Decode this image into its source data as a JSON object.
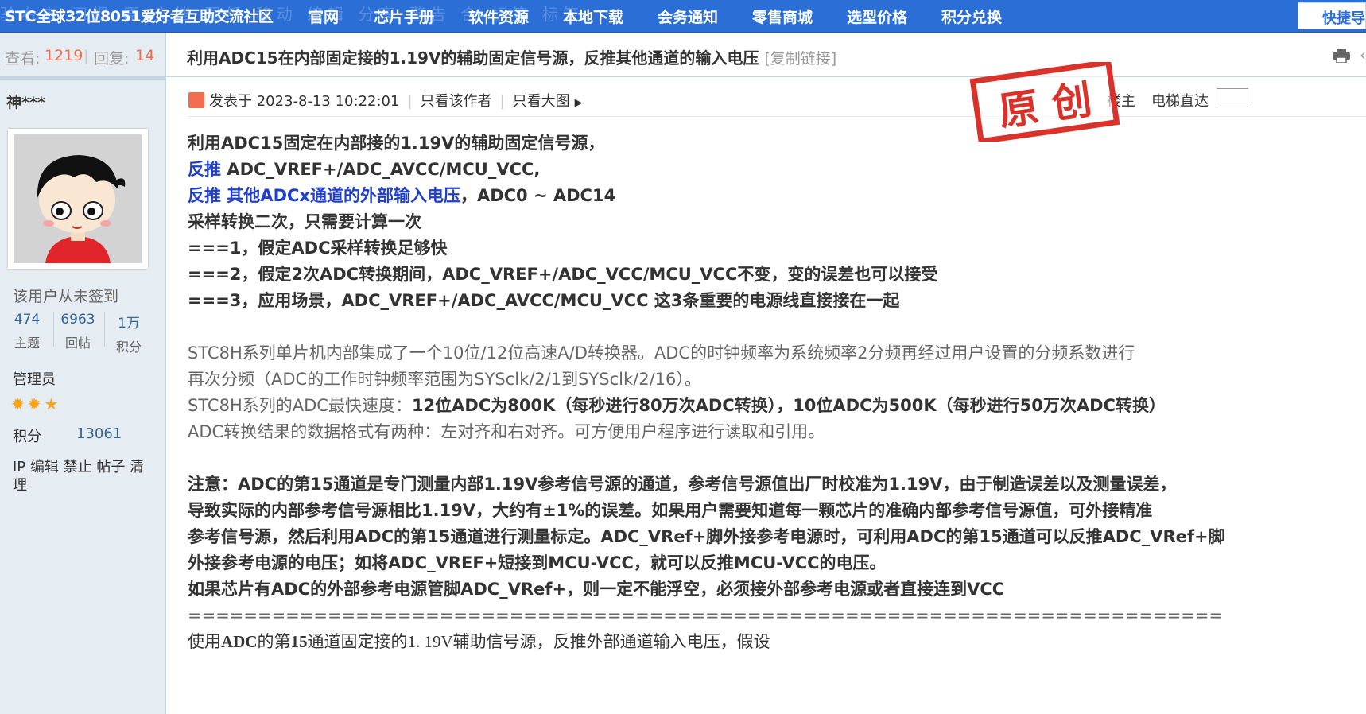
{
  "topnav": {
    "site_title": "STC全球32位8051爱好者互助交流社区",
    "ghost_text": "验右市 习惯 原 文档 图纸 移动 编辑 分享 警告 合 标签 标签",
    "items": [
      "官网",
      "芯片手册",
      "软件资源",
      "本地下载",
      "会务通知",
      "零售商城",
      "选型价格",
      "积分兑换"
    ],
    "quick_label": "快捷导"
  },
  "stats": {
    "views_label": "查看:",
    "views": "1219",
    "replies_label": "回复:",
    "replies": "14"
  },
  "thread": {
    "title": "利用ADC15在内部固定接的1.19V的辅助固定信号源，反推其他通道的输入电压",
    "copy_link": "[复制链接]"
  },
  "author": {
    "name": "神***",
    "signin": "该用户从未签到",
    "stats": [
      {
        "value": "474",
        "label": "主题"
      },
      {
        "value": "6963",
        "label": "回帖"
      },
      {
        "value": "1万",
        "label": "积分"
      }
    ],
    "role": "管理员",
    "credit_label": "积分",
    "credit_value": "13061",
    "actions": "IP 编辑 禁止 帖子 清理"
  },
  "post_meta": {
    "posted": "发表于 2023-8-13 10:22:01",
    "author_only": "只看该作者",
    "big_image": "只看大图",
    "floor": "楼主",
    "elevator": "电梯直达"
  },
  "stamp_text": "原 创",
  "content": {
    "l1": "利用ADC15固定在内部接的1.19V的辅助固定信号源，",
    "l2a": "反推",
    "l2b": " ADC_VREF+/ADC_AVCC/MCU_VCC,",
    "l3a": "反推 其他ADCx通道的外部输入电压",
    "l3b": "，ADC0 ~ ADC14",
    "l4": "采样转换二次，只需要计算一次",
    "l5": "===1，假定ADC采样转换足够快",
    "l6": "===2，假定2次ADC转换期间，ADC_VREF+/ADC_VCC/MCU_VCC不变，变的误差也可以接受",
    "l7": "===3，应用场景，ADC_VREF+/ADC_AVCC/MCU_VCC 这3条重要的电源线直接接在一起",
    "p1": "STC8H系列单片机内部集成了一个10位/12位高速A/D转换器。ADC的时钟频率为系统频率2分频再经过用户设置的分频系数进行",
    "p2": "再次分频（ADC的工作时钟频率范围为SYSclk/2/1到SYSclk/2/16）。",
    "p3a": "STC8H系列的ADC最快速度：",
    "p3b": "12位ADC为800K（每秒进行80万次ADC转换），10位ADC为500K（每秒进行50万次ADC转换）",
    "p4": "ADC转换结果的数据格式有两种：左对齐和右对齐。可方便用户程序进行读取和引用。",
    "n1": "注意：ADC的第15通道是专门测量内部1.19V参考信号源的通道，参考信号源值出厂时校准为1.19V，由于制造误差以及测量误差，",
    "n2": "导致实际的内部参考信号源相比1.19V，大约有±1%的误差。如果用户需要知道每一颗芯片的准确内部参考信号源值，可外接精准",
    "n3": "参考信号源，然后利用ADC的第15通道进行测量标定。ADC_VRef+脚外接参考电源时，可利用ADC的第15通道可以反推ADC_VRef+脚",
    "n4": "外接参考电源的电压；如将ADC_VREF+短接到MCU-VCC，就可以反推MCU-VCC的电压。",
    "n5": "如果芯片有ADC的外部参考电源管脚ADC_VRef+，则一定不能浮空，必须接外部参考电源或者直接连到VCC",
    "divider": "==========================================================================",
    "last_a": "使用",
    "last_b": "ADC",
    "last_c": "的第",
    "last_d": "15",
    "last_e": "通道固定接的1. 19V辅助信号源，反推外部通道输入电压，假设"
  }
}
